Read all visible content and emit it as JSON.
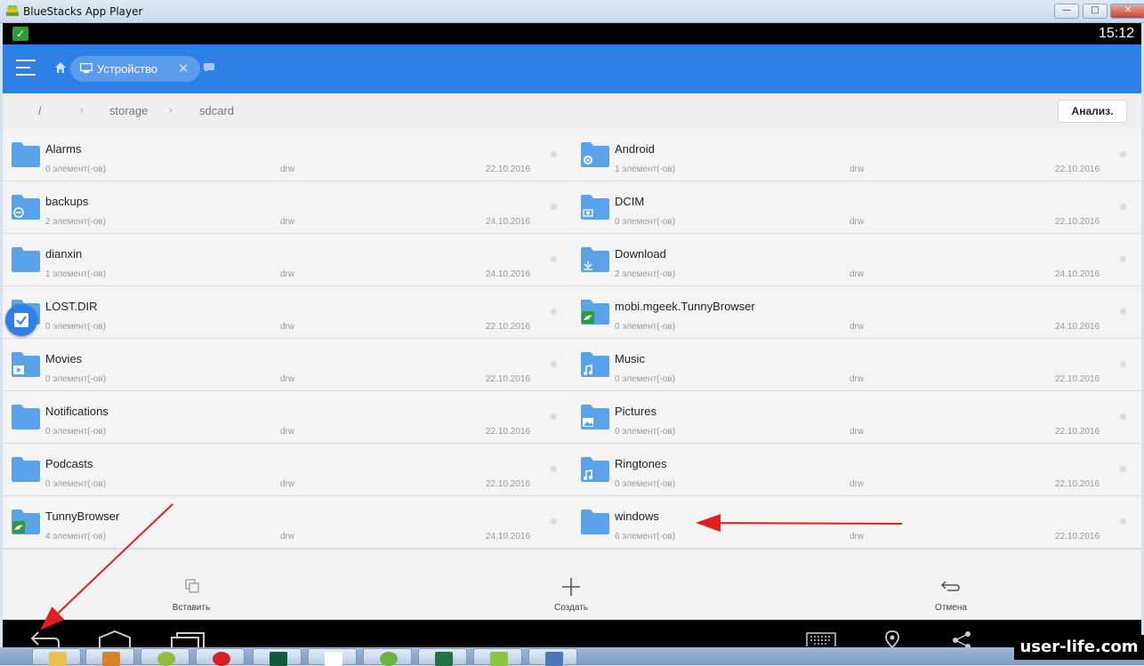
{
  "window": {
    "title": "BlueStacks App Player",
    "minimize": "—",
    "maximize": "□",
    "close": "✕"
  },
  "statusbar": {
    "time": "15:12"
  },
  "appbar": {
    "tab_label": "Устройство"
  },
  "path": {
    "root": "/",
    "seg1": "storage",
    "seg2": "sdcard",
    "analyze_button": "Анализ."
  },
  "files": [
    {
      "name": "Alarms",
      "count": "0 элемент(-ов)",
      "perm": "drw",
      "date": "22.10.2016",
      "badge": ""
    },
    {
      "name": "Android",
      "count": "1 элемент(-ов)",
      "perm": "drw",
      "date": "22.10.2016",
      "badge": "gear"
    },
    {
      "name": "backups",
      "count": "2 элемент(-ов)",
      "perm": "drw",
      "date": "24.10.2016",
      "badge": "sync"
    },
    {
      "name": "DCIM",
      "count": "0 элемент(-ов)",
      "perm": "drw",
      "date": "22.10.2016",
      "badge": "camera"
    },
    {
      "name": "dianxin",
      "count": "1 элемент(-ов)",
      "perm": "drw",
      "date": "24.10.2016",
      "badge": ""
    },
    {
      "name": "Download",
      "count": "2 элемент(-ов)",
      "perm": "drw",
      "date": "24.10.2016",
      "badge": "download"
    },
    {
      "name": "LOST.DIR",
      "count": "0 элемент(-ов)",
      "perm": "drw",
      "date": "22.10.2016",
      "badge": ""
    },
    {
      "name": "mobi.mgeek.TunnyBrowser",
      "count": "0 элемент(-ов)",
      "perm": "drw",
      "date": "24.10.2016",
      "badge": "dolphin"
    },
    {
      "name": "Movies",
      "count": "0 элемент(-ов)",
      "perm": "drw",
      "date": "22.10.2016",
      "badge": "video"
    },
    {
      "name": "Music",
      "count": "0 элемент(-ов)",
      "perm": "drw",
      "date": "22.10.2016",
      "badge": "music"
    },
    {
      "name": "Notifications",
      "count": "0 элемент(-ов)",
      "perm": "drw",
      "date": "22.10.2016",
      "badge": ""
    },
    {
      "name": "Pictures",
      "count": "0 элемент(-ов)",
      "perm": "drw",
      "date": "22.10.2016",
      "badge": "image"
    },
    {
      "name": "Podcasts",
      "count": "0 элемент(-ов)",
      "perm": "drw",
      "date": "22.10.2016",
      "badge": ""
    },
    {
      "name": "Ringtones",
      "count": "0 элемент(-ов)",
      "perm": "drw",
      "date": "22.10.2016",
      "badge": "music"
    },
    {
      "name": "TunnyBrowser",
      "count": "4 элемент(-ов)",
      "perm": "drw",
      "date": "24.10.2016",
      "badge": "dolphin"
    },
    {
      "name": "windows",
      "count": "6 элемент(-ов)",
      "perm": "drw",
      "date": "22.10.2016",
      "badge": ""
    }
  ],
  "actions": {
    "paste": "Вставить",
    "create": "Создать",
    "cancel": "Отмена"
  },
  "watermark": "user-life.com",
  "colors": {
    "accent": "#2f80e6",
    "folder": "#5aa3e8",
    "annotation_arrow": "#e02020"
  }
}
